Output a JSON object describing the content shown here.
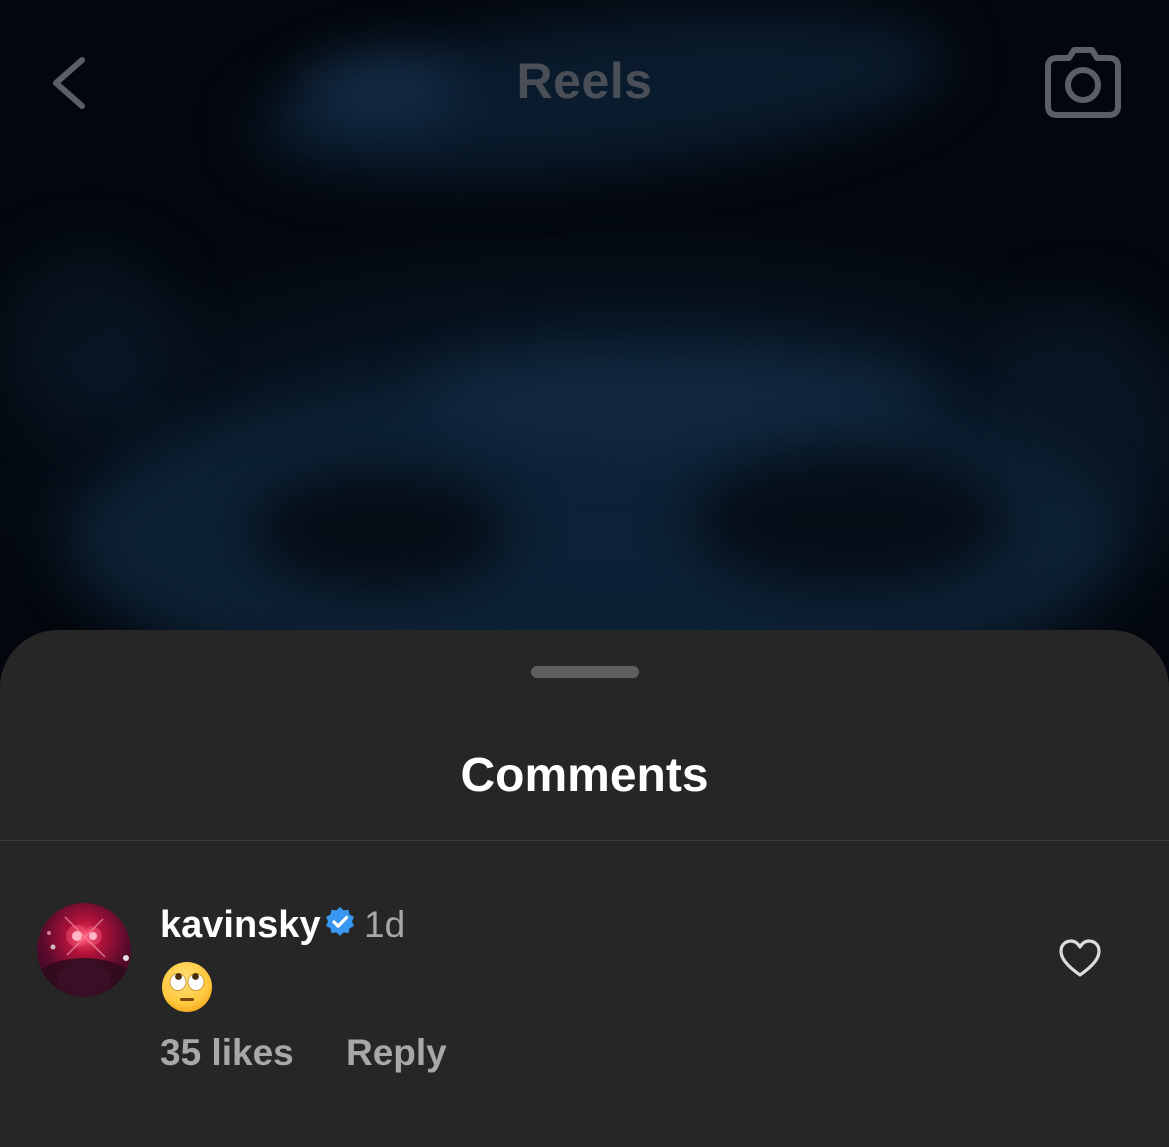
{
  "header": {
    "title": "Reels",
    "back_icon": "chevron-left-icon",
    "camera_icon": "camera-icon"
  },
  "comments_sheet": {
    "title": "Comments",
    "comments": [
      {
        "username": "kavinsky",
        "verified": true,
        "time": "1d",
        "text": "🙄",
        "likes": "35 likes",
        "reply_label": "Reply"
      }
    ]
  },
  "colors": {
    "sheet_background": "#262626",
    "verified_badge": "#3897f0",
    "secondary_text": "#a8a8a8",
    "header_title": "#4a4f57"
  }
}
